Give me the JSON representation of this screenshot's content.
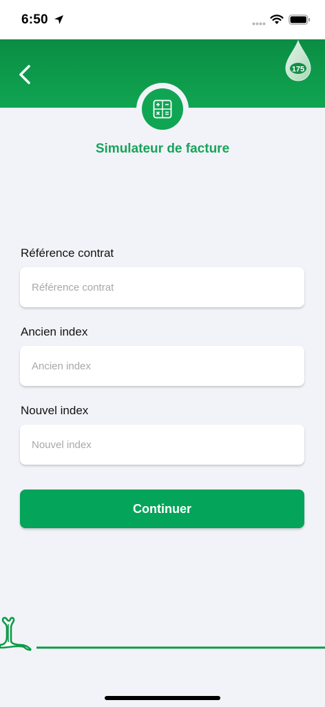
{
  "status_bar": {
    "time": "6:50",
    "icons": [
      "location-arrow-icon",
      "signal-dots-icon",
      "wifi-icon",
      "battery-icon"
    ]
  },
  "header": {
    "back_icon": "chevron-left-icon",
    "logo_text": "175",
    "logo_icon": "water-drop-logo-icon",
    "section_icon": "calculator-icon",
    "title": "Simulateur de facture"
  },
  "form": {
    "fields": [
      {
        "label": "Référence contrat",
        "placeholder": "Référence contrat",
        "value": ""
      },
      {
        "label": "Ancien index",
        "placeholder": "Ancien index",
        "value": ""
      },
      {
        "label": "Nouvel index",
        "placeholder": "Nouvel index",
        "value": ""
      }
    ],
    "submit_label": "Continuer"
  },
  "colors": {
    "brand_green": "#10a552",
    "header_green_dark": "#0a8d43",
    "button_green": "#04a45a",
    "title_green": "#17a35a",
    "background": "#f2f3f8"
  }
}
